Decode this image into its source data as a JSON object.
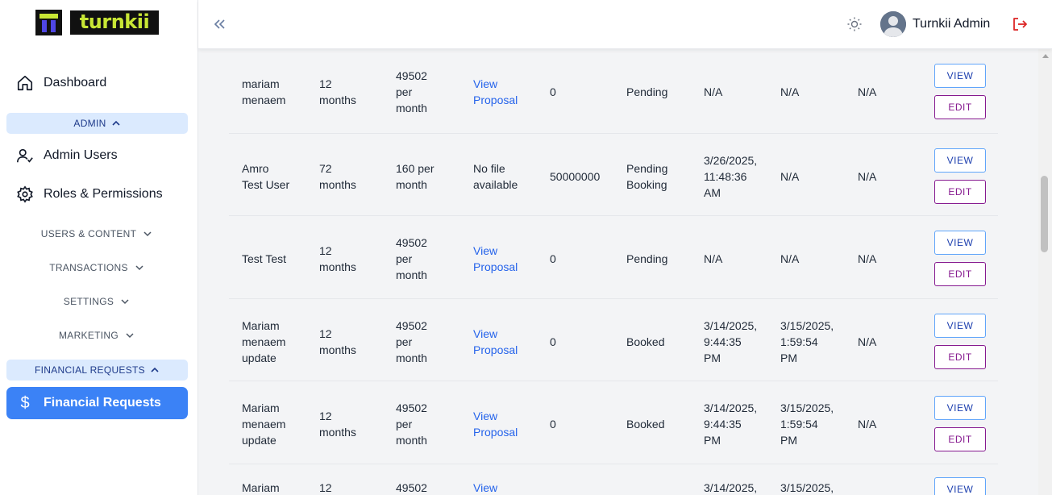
{
  "logo": {
    "wordmark": "turnkii"
  },
  "sidebar": {
    "dashboard": "Dashboard",
    "admin_section": "ADMIN",
    "admin_users": "Admin Users",
    "roles": "Roles & Permissions",
    "users_content": "USERS & CONTENT",
    "transactions": "TRANSACTIONS",
    "settings": "SETTINGS",
    "marketing": "MARKETING",
    "financial_section": "FINANCIAL REQUESTS",
    "financial_requests": "Financial Requests",
    "financial_icon": "$"
  },
  "header": {
    "user_name": "Turnkii Admin"
  },
  "actions": {
    "view": "VIEW",
    "edit": "EDIT"
  },
  "rows": [
    {
      "name": [
        "mariam",
        "menaem"
      ],
      "term": [
        "12",
        "months"
      ],
      "payment": [
        "49502",
        "per",
        "month"
      ],
      "file": [
        "View",
        "Proposal"
      ],
      "file_link": true,
      "amount": "0",
      "status": [
        "Pending"
      ],
      "date1": [
        "N/A"
      ],
      "date2": [
        "N/A"
      ],
      "date3": [
        "N/A"
      ]
    },
    {
      "name": [
        "Amro",
        "Test User"
      ],
      "term": [
        "72",
        "months"
      ],
      "payment": [
        "160 per",
        "month"
      ],
      "file": [
        "No file",
        "available"
      ],
      "file_link": false,
      "amount": "50000000",
      "status": [
        "Pending",
        "Booking"
      ],
      "date1": [
        "3/26/2025,",
        "11:48:36",
        "AM"
      ],
      "date2": [
        "N/A"
      ],
      "date3": [
        "N/A"
      ]
    },
    {
      "name": [
        "Test Test"
      ],
      "term": [
        "12",
        "months"
      ],
      "payment": [
        "49502",
        "per",
        "month"
      ],
      "file": [
        "View",
        "Proposal"
      ],
      "file_link": true,
      "amount": "0",
      "status": [
        "Pending"
      ],
      "date1": [
        "N/A"
      ],
      "date2": [
        "N/A"
      ],
      "date3": [
        "N/A"
      ]
    },
    {
      "name": [
        "Mariam",
        "menaem",
        "update"
      ],
      "term": [
        "12",
        "months"
      ],
      "payment": [
        "49502",
        "per",
        "month"
      ],
      "file": [
        "View",
        "Proposal"
      ],
      "file_link": true,
      "amount": "0",
      "status": [
        "Booked"
      ],
      "date1": [
        "3/14/2025,",
        "9:44:35",
        "PM"
      ],
      "date2": [
        "3/15/2025,",
        "1:59:54",
        "PM"
      ],
      "date3": [
        "N/A"
      ]
    },
    {
      "name": [
        "Mariam",
        "menaem",
        "update"
      ],
      "term": [
        "12",
        "months"
      ],
      "payment": [
        "49502",
        "per",
        "month"
      ],
      "file": [
        "View",
        "Proposal"
      ],
      "file_link": true,
      "amount": "0",
      "status": [
        "Booked"
      ],
      "date1": [
        "3/14/2025,",
        "9:44:35",
        "PM"
      ],
      "date2": [
        "3/15/2025,",
        "1:59:54",
        "PM"
      ],
      "date3": [
        "N/A"
      ]
    },
    {
      "name": [
        "Mariam"
      ],
      "term": [
        "12"
      ],
      "payment": [
        "49502"
      ],
      "file": [
        "View"
      ],
      "file_link": true,
      "amount": "",
      "status": [],
      "date1": [
        "3/14/2025,"
      ],
      "date2": [
        "3/15/2025,"
      ],
      "date3": []
    }
  ],
  "colors": {
    "accent": "#3b82f6",
    "section_bg": "#dbeafe",
    "edit": "#86198f",
    "view": "#60a5fa"
  }
}
